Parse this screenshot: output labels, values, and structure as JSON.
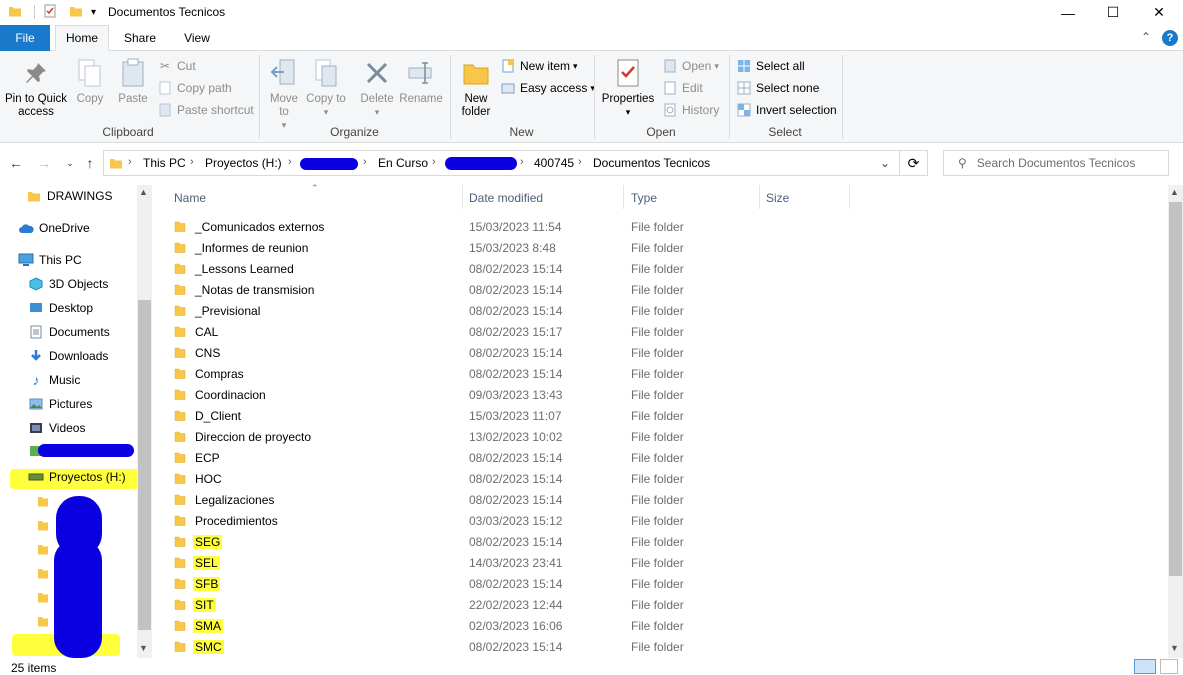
{
  "window": {
    "title": "Documentos Tecnicos",
    "controls": {
      "minimize": "—",
      "maximize": "☐",
      "close": "✕"
    }
  },
  "ribbon_tabs": [
    "File",
    "Home",
    "Share",
    "View"
  ],
  "ribbon": {
    "clipboard": {
      "label": "Clipboard",
      "pin": "Pin to Quick access",
      "copy": "Copy",
      "paste": "Paste",
      "cut": "Cut",
      "copy_path": "Copy path",
      "paste_shortcut": "Paste shortcut"
    },
    "organize": {
      "label": "Organize",
      "move_to": "Move to",
      "copy_to": "Copy to",
      "delete": "Delete",
      "rename": "Rename"
    },
    "new": {
      "label": "New",
      "new_folder": "New folder",
      "new_item": "New item",
      "easy_access": "Easy access"
    },
    "open": {
      "label": "Open",
      "properties": "Properties",
      "open": "Open",
      "edit": "Edit",
      "history": "History"
    },
    "select": {
      "label": "Select",
      "select_all": "Select all",
      "select_none": "Select none",
      "invert_selection": "Invert selection"
    }
  },
  "address": {
    "crumbs": [
      "This PC",
      "Proyectos (H:)",
      "En Curso",
      "400745",
      "Documentos Tecnicos"
    ],
    "search_placeholder": "Search Documentos Tecnicos"
  },
  "nav_pane": {
    "items": [
      {
        "label": "DRAWINGS",
        "icon": "folder-icon"
      },
      {
        "label": "OneDrive",
        "icon": "cloud-icon"
      },
      {
        "label": "This PC",
        "icon": "computer-icon"
      },
      {
        "label": "3D Objects",
        "icon": "cube-icon"
      },
      {
        "label": "Desktop",
        "icon": "desktop-icon"
      },
      {
        "label": "Documents",
        "icon": "documents-icon"
      },
      {
        "label": "Downloads",
        "icon": "download-icon"
      },
      {
        "label": "Music",
        "icon": "music-icon"
      },
      {
        "label": "Pictures",
        "icon": "pictures-icon"
      },
      {
        "label": "Videos",
        "icon": "videos-icon"
      },
      {
        "label": "Proyectos (H:)",
        "icon": "network-drive-icon"
      }
    ]
  },
  "columns": {
    "name": "Name",
    "date": "Date modified",
    "type": "Type",
    "size": "Size"
  },
  "files": [
    {
      "name": "_Comunicados externos",
      "date": "15/03/2023 11:54",
      "type": "File folder",
      "highlight": false
    },
    {
      "name": "_Informes de reunion",
      "date": "15/03/2023 8:48",
      "type": "File folder",
      "highlight": false
    },
    {
      "name": "_Lessons Learned",
      "date": "08/02/2023 15:14",
      "type": "File folder",
      "highlight": false
    },
    {
      "name": "_Notas de transmision",
      "date": "08/02/2023 15:14",
      "type": "File folder",
      "highlight": false
    },
    {
      "name": "_Previsional",
      "date": "08/02/2023 15:14",
      "type": "File folder",
      "highlight": false
    },
    {
      "name": "CAL",
      "date": "08/02/2023 15:17",
      "type": "File folder",
      "highlight": false
    },
    {
      "name": "CNS",
      "date": "08/02/2023 15:14",
      "type": "File folder",
      "highlight": false
    },
    {
      "name": "Compras",
      "date": "08/02/2023 15:14",
      "type": "File folder",
      "highlight": false
    },
    {
      "name": "Coordinacion",
      "date": "09/03/2023 13:43",
      "type": "File folder",
      "highlight": false
    },
    {
      "name": "D_Client",
      "date": "15/03/2023 11:07",
      "type": "File folder",
      "highlight": false
    },
    {
      "name": "Direccion de proyecto",
      "date": "13/02/2023 10:02",
      "type": "File folder",
      "highlight": false
    },
    {
      "name": "ECP",
      "date": "08/02/2023 15:14",
      "type": "File folder",
      "highlight": false
    },
    {
      "name": "HOC",
      "date": "08/02/2023 15:14",
      "type": "File folder",
      "highlight": false
    },
    {
      "name": "Legalizaciones",
      "date": "08/02/2023 15:14",
      "type": "File folder",
      "highlight": false
    },
    {
      "name": "Procedimientos",
      "date": "03/03/2023 15:12",
      "type": "File folder",
      "highlight": false
    },
    {
      "name": "SEG",
      "date": "08/02/2023 15:14",
      "type": "File folder",
      "highlight": true
    },
    {
      "name": "SEL",
      "date": "14/03/2023 23:41",
      "type": "File folder",
      "highlight": true
    },
    {
      "name": "SFB",
      "date": "08/02/2023 15:14",
      "type": "File folder",
      "highlight": true
    },
    {
      "name": "SIT",
      "date": "22/02/2023 12:44",
      "type": "File folder",
      "highlight": true
    },
    {
      "name": "SMA",
      "date": "02/03/2023 16:06",
      "type": "File folder",
      "highlight": true
    },
    {
      "name": "SMC",
      "date": "08/02/2023 15:14",
      "type": "File folder",
      "highlight": true
    }
  ],
  "status": {
    "count": "25 items"
  },
  "colors": {
    "accent": "#1979ca",
    "folder": "#f8c64a",
    "highlight": "#ffff3c",
    "redaction": "#0a00e0"
  }
}
